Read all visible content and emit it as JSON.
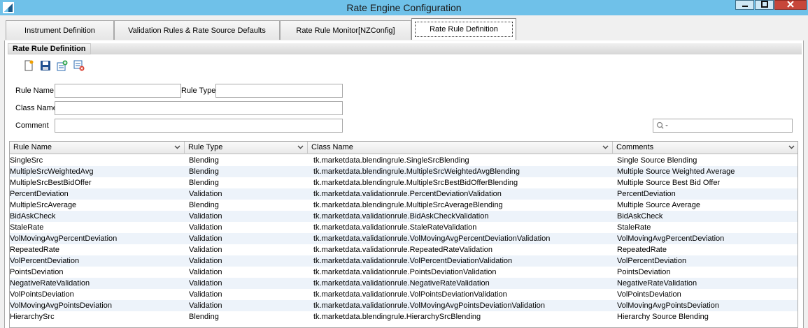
{
  "window": {
    "title": "Rate Engine Configuration"
  },
  "tabs": [
    {
      "label": "Instrument Definition",
      "active": false
    },
    {
      "label": "Validation Rules & Rate Source Defaults",
      "active": false
    },
    {
      "label": "Rate Rule Monitor[NZConfig]",
      "active": false
    },
    {
      "label": "Rate Rule Definition",
      "active": true
    }
  ],
  "section": {
    "title": "Rate Rule Definition"
  },
  "toolbar": {
    "icons": [
      "new-document-icon",
      "save-icon",
      "add-rule-icon",
      "delete-rule-icon"
    ]
  },
  "form": {
    "rule_name_label": "Rule Name",
    "rule_name_value": "",
    "rule_type_label": "Rule Type",
    "rule_type_value": "",
    "class_name_label": "Class Name",
    "class_name_value": "",
    "comment_label": "Comment",
    "comment_value": ""
  },
  "search": {
    "value": ""
  },
  "table": {
    "columns": [
      "Rule Name",
      "Rule Type",
      "Class Name",
      "Comments"
    ],
    "rows": [
      [
        "SingleSrc",
        "Blending",
        "tk.marketdata.blendingrule.SingleSrcBlending",
        "Single Source Blending"
      ],
      [
        "MultipleSrcWeightedAvg",
        "Blending",
        "tk.marketdata.blendingrule.MultipleSrcWeightedAvgBlending",
        "Multiple Source Weighted Average"
      ],
      [
        "MultipleSrcBestBidOffer",
        "Blending",
        "tk.marketdata.blendingrule.MultipleSrcBestBidOfferBlending",
        "Multiple Source Best Bid Offer"
      ],
      [
        "PercentDeviation",
        "Validation",
        "tk.marketdata.validationrule.PercentDeviationValidation",
        "PercentDeviation"
      ],
      [
        "MultipleSrcAverage",
        "Blending",
        "tk.marketdata.blendingrule.MultipleSrcAverageBlending",
        "Multiple Source Average"
      ],
      [
        "BidAskCheck",
        "Validation",
        "tk.marketdata.validationrule.BidAskCheckValidation",
        "BidAskCheck"
      ],
      [
        "StaleRate",
        "Validation",
        "tk.marketdata.validationrule.StaleRateValidation",
        "StaleRate"
      ],
      [
        "VolMovingAvgPercentDeviation",
        "Validation",
        "tk.marketdata.validationrule.VolMovingAvgPercentDeviationValidation",
        "VolMovingAvgPercentDeviation"
      ],
      [
        "RepeatedRate",
        "Validation",
        "tk.marketdata.validationrule.RepeatedRateValidation",
        "RepeatedRate"
      ],
      [
        "VolPercentDeviation",
        "Validation",
        "tk.marketdata.validationrule.VolPercentDeviationValidation",
        "VolPercentDeviation"
      ],
      [
        "PointsDeviation",
        "Validation",
        "tk.marketdata.validationrule.PointsDeviationValidation",
        "PointsDeviation"
      ],
      [
        "NegativeRateValidation",
        "Validation",
        "tk.marketdata.validationrule.NegativeRateValidation",
        "NegativeRateValidation"
      ],
      [
        "VolPointsDeviation",
        "Validation",
        "tk.marketdata.validationrule.VolPointsDeviationValidation",
        "VolPointsDeviation"
      ],
      [
        "VolMovingAvgPointsDeviation",
        "Validation",
        "tk.marketdata.validationrule.VolMovingAvgPointsDeviationValidation",
        "VolMovingAvgPointsDeviation"
      ],
      [
        "HierarchySrc",
        "Blending",
        "tk.marketdata.blendingrule.HierarchySrcBlending",
        "Hierarchy Source Blending"
      ]
    ]
  }
}
